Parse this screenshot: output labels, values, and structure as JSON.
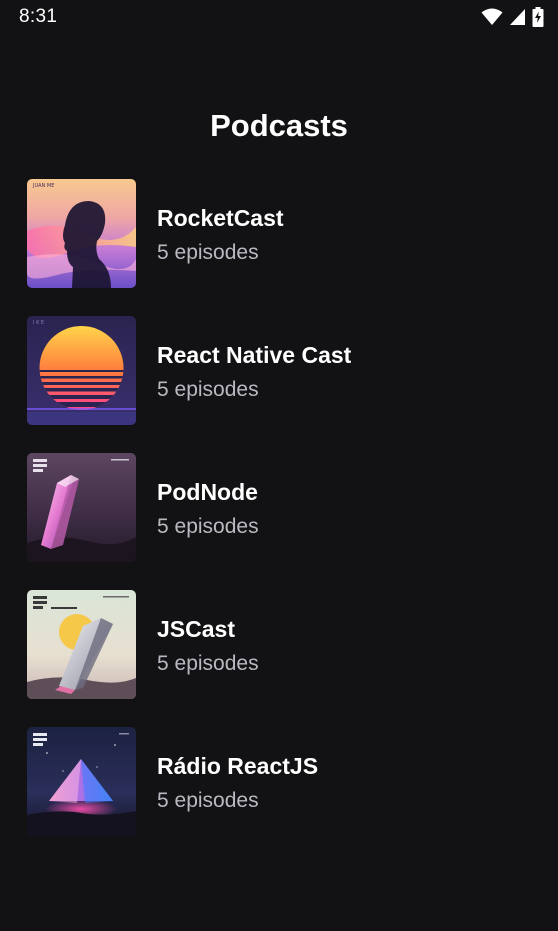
{
  "status_bar": {
    "time": "8:31",
    "icons": [
      "wifi-icon",
      "cellular-signal-icon",
      "battery-charging-icon"
    ]
  },
  "header": {
    "title": "Podcasts"
  },
  "podcasts": [
    {
      "name": "RocketCast",
      "episodes": "5 episodes",
      "cover": "cover-art-silhouette"
    },
    {
      "name": "React Native Cast",
      "episodes": "5 episodes",
      "cover": "cover-art-synthwave-sunset"
    },
    {
      "name": "PodNode",
      "episodes": "5 episodes",
      "cover": "cover-art-crystal-pink"
    },
    {
      "name": "JSCast",
      "episodes": "5 episodes",
      "cover": "cover-art-crystal-sun"
    },
    {
      "name": "Rádio ReactJS",
      "episodes": "5 episodes",
      "cover": "cover-art-pyramid"
    }
  ],
  "colors": {
    "background": "#121214",
    "title_text": "#ffffff",
    "secondary_text": "#b9b9c2"
  }
}
